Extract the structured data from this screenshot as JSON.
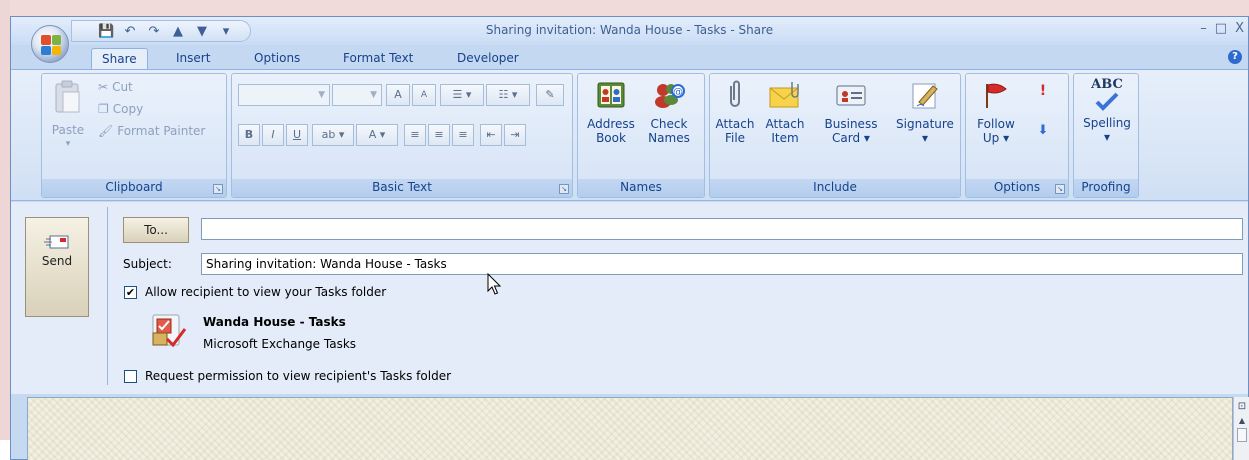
{
  "window": {
    "title": "Sharing invitation: Wanda House - Tasks - Share",
    "controls": {
      "minimize": "–",
      "restore": "□",
      "close": "X"
    }
  },
  "qat": {
    "save": "💾",
    "undo": "↶",
    "redo": "↷",
    "up": "▲",
    "down": "▼",
    "more": "▾"
  },
  "tabs": [
    "Share",
    "Insert",
    "Options",
    "Format Text",
    "Developer"
  ],
  "ribbon": {
    "clipboard": {
      "label": "Clipboard",
      "paste": "Paste",
      "cut": "Cut",
      "copy": "Copy",
      "format_painter": "Format Painter"
    },
    "basic_text": {
      "label": "Basic Text",
      "bold": "B",
      "italic": "I",
      "underline": "U",
      "grow": "A",
      "shrink": "A"
    },
    "names": {
      "label": "Names",
      "address_book_1": "Address",
      "address_book_2": "Book",
      "check_names_1": "Check",
      "check_names_2": "Names"
    },
    "include": {
      "label": "Include",
      "attach_file_1": "Attach",
      "attach_file_2": "File",
      "attach_item_1": "Attach",
      "attach_item_2": "Item",
      "business_card_1": "Business",
      "business_card_2": "Card ▾",
      "signature_1": "Signature",
      "signature_2": "▾"
    },
    "options": {
      "label": "Options",
      "follow_up_1": "Follow",
      "follow_up_2": "Up ▾",
      "high_importance": "!",
      "low_importance": "⬇"
    },
    "proofing": {
      "label": "Proofing",
      "abc": "ABC",
      "spelling_1": "Spelling",
      "spelling_2": "▾"
    }
  },
  "message": {
    "send_label": "Send",
    "to_label": "To...",
    "to_value": "",
    "subject_label": "Subject:",
    "subject_value": "Sharing invitation: Wanda House - Tasks",
    "allow_label": "Allow recipient to view your Tasks folder",
    "allow_checked": "✔",
    "folder_name": "Wanda House - Tasks",
    "folder_type": "Microsoft Exchange Tasks",
    "request_label": "Request permission to view recipient's Tasks folder",
    "request_checked": ""
  },
  "colors": {
    "accent": "#15428b",
    "ribbon_bg": "#dbe7f7",
    "window_frame": "#c5d9f1"
  }
}
